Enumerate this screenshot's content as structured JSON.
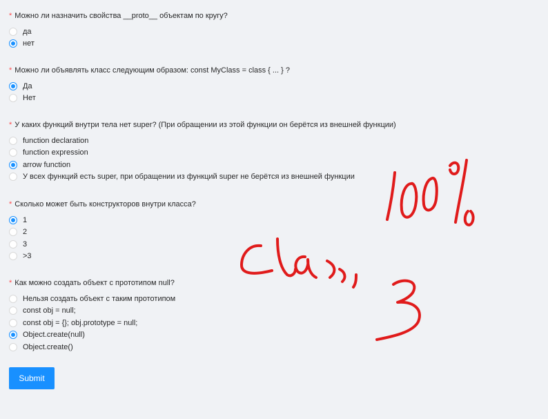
{
  "required_mark": "*",
  "questions": [
    {
      "text": "Можно ли назначить свойства __proto__ объектам по кругу?",
      "options": [
        "да",
        "нет"
      ],
      "selected": 1
    },
    {
      "text": "Можно ли объявлять класс следующим образом: const MyClass = class { ... } ?",
      "options": [
        "Да",
        "Нет"
      ],
      "selected": 0
    },
    {
      "text": "У каких функций внутри тела нет super? (При обращении из этой функции он берётся из внешней функции)",
      "options": [
        "function declaration",
        "function expression",
        "arrow function",
        "У всех функций есть super, при обращении из функций super не берётся из внешней функции"
      ],
      "selected": 2
    },
    {
      "text": "Сколько может быть конструкторов внутри класса?",
      "options": [
        "1",
        "2",
        "3",
        ">3"
      ],
      "selected": 0
    },
    {
      "text": "Как можно создать объект с прототипом null?",
      "options": [
        "Нельзя создать объект с таким прототипом",
        "const obj = null;",
        "const obj = {}; obj.prototype = null;",
        "Object.create(null)",
        "Object.create()"
      ],
      "selected": 3
    }
  ],
  "submit_label": "Submit",
  "handwriting": {
    "text": "100% class, 3",
    "color": "#e01b1b"
  },
  "colors": {
    "background": "#f0f2f5",
    "primary": "#1890ff",
    "required": "#ff4d4f"
  }
}
